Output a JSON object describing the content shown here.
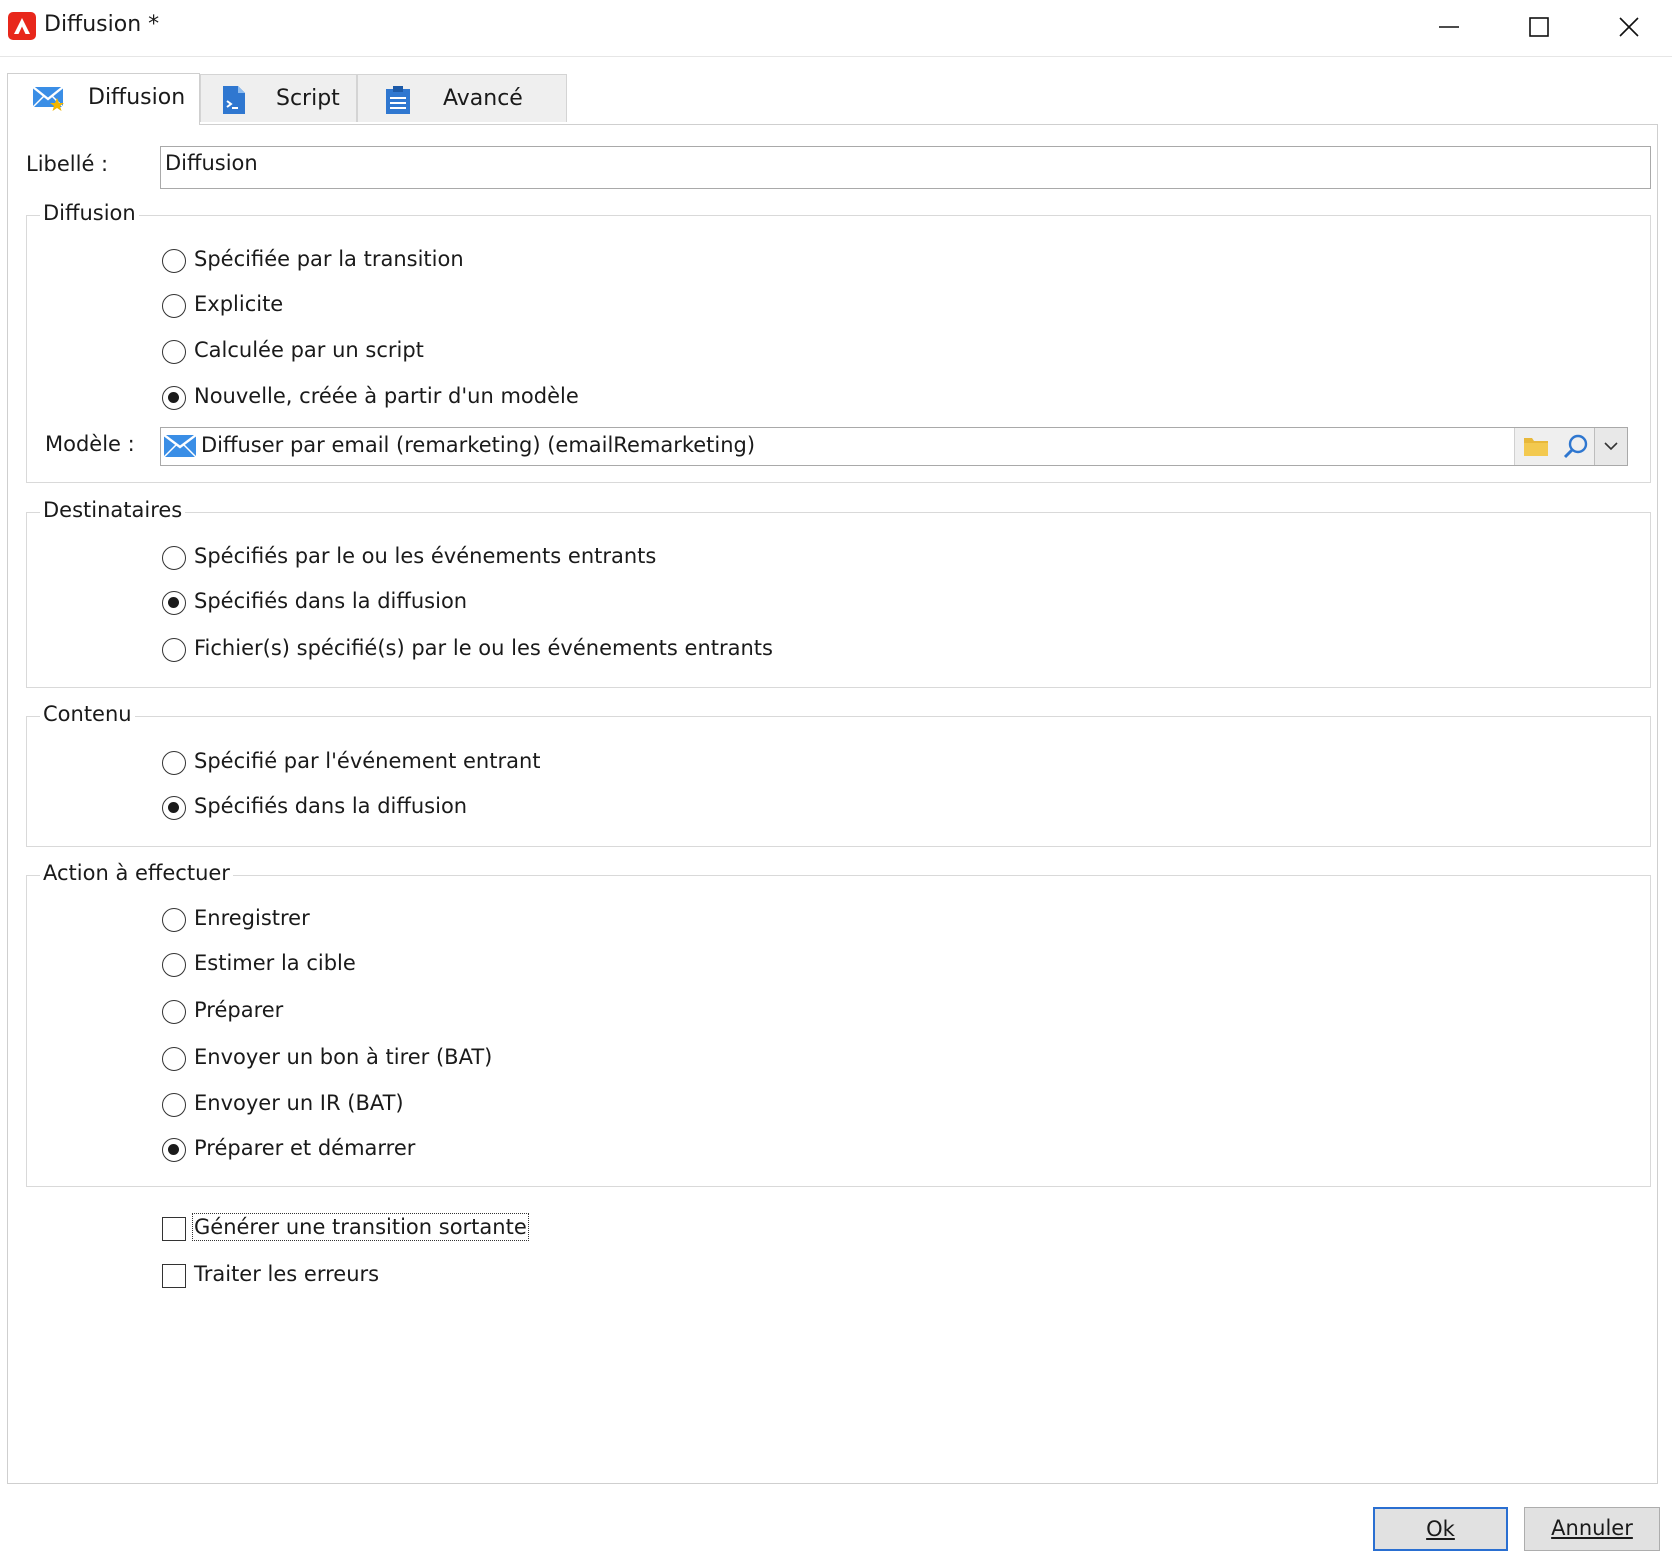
{
  "window": {
    "title": "Diffusion *"
  },
  "tabs": [
    {
      "label": "Diffusion",
      "icon": "email-star-icon",
      "active": true
    },
    {
      "label": "Script",
      "icon": "script-icon",
      "active": false
    },
    {
      "label": "Avancé",
      "icon": "clipboard-icon",
      "active": false
    }
  ],
  "libelle": {
    "label": "Libellé :",
    "value": "Diffusion"
  },
  "diffusion_group": {
    "legend": "Diffusion",
    "options": [
      {
        "label": "Spécifiée par la transition",
        "checked": false
      },
      {
        "label": "Explicite",
        "checked": false
      },
      {
        "label": "Calculée par un script",
        "checked": false
      },
      {
        "label": "Nouvelle, créée à partir d'un modèle",
        "checked": true
      }
    ],
    "model_label": "Modèle :",
    "model_value": "Diffuser par email (remarketing) (emailRemarketing)"
  },
  "destinataires_group": {
    "legend": "Destinataires",
    "options": [
      {
        "label": "Spécifiés par le ou les événements entrants",
        "checked": false
      },
      {
        "label": "Spécifiés dans la diffusion",
        "checked": true
      },
      {
        "label": "Fichier(s) spécifié(s) par le ou les événements entrants",
        "checked": false
      }
    ]
  },
  "contenu_group": {
    "legend": "Contenu",
    "options": [
      {
        "label": "Spécifié par l'événement entrant",
        "checked": false
      },
      {
        "label": "Spécifiés dans la diffusion",
        "checked": true
      }
    ]
  },
  "action_group": {
    "legend": "Action à effectuer",
    "options": [
      {
        "label": "Enregistrer",
        "checked": false
      },
      {
        "label": "Estimer la cible",
        "checked": false
      },
      {
        "label": "Préparer",
        "checked": false
      },
      {
        "label": "Envoyer un bon à tirer (BAT)",
        "checked": false
      },
      {
        "label": "Envoyer un IR (BAT)",
        "checked": false
      },
      {
        "label": "Préparer et démarrer",
        "checked": true
      }
    ]
  },
  "checkboxes": [
    {
      "label": "Générer une transition sortante",
      "checked": false
    },
    {
      "label": "Traiter les erreurs",
      "checked": false
    }
  ],
  "buttons": {
    "ok": "Ok",
    "cancel": "Annuler"
  },
  "colors": {
    "accent": "#2a6fd1",
    "logo": "#e8271b",
    "folder": "#e8b83a"
  }
}
